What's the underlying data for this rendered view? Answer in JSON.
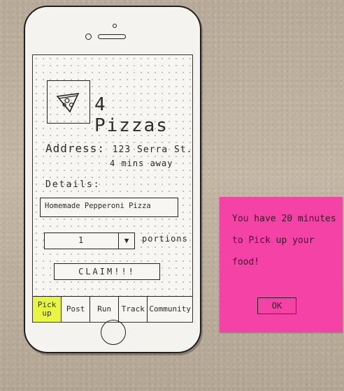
{
  "food": {
    "title": "4 Pizzas",
    "icon": "pizza-slice-icon",
    "address_label": "Address:",
    "address": "123 Serra St.",
    "distance": "4 mins away"
  },
  "details": {
    "label": "Details:",
    "text": "Homemade Pepperoni Pizza"
  },
  "portions": {
    "selected": "1",
    "label": "portions"
  },
  "claim_label": "CLAIM!!!",
  "tabs": [
    {
      "label": "Pick up",
      "active": true
    },
    {
      "label": "Post"
    },
    {
      "label": "Run"
    },
    {
      "label": "Track"
    },
    {
      "label": "Community"
    }
  ],
  "popup": {
    "message": "You have 20 minutes to Pick up your food!",
    "ok_label": "OK"
  },
  "colors": {
    "sticky_note": "#f542a7",
    "active_tab": "#e8f542"
  }
}
